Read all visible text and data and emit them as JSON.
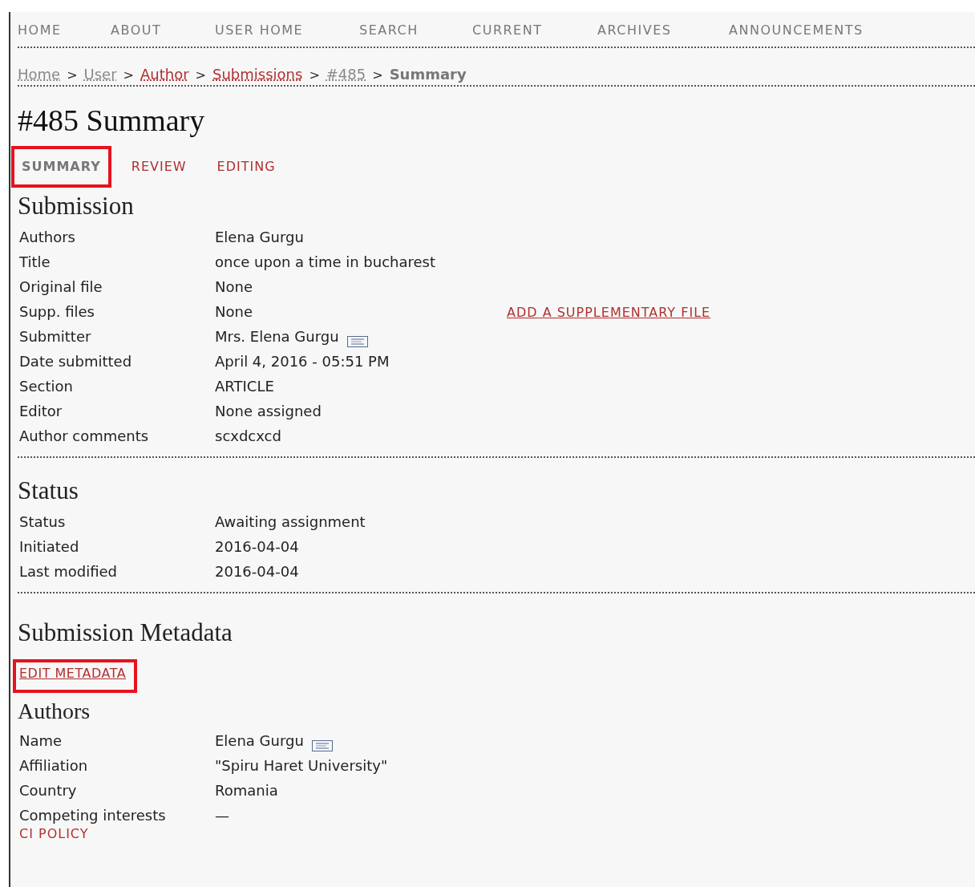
{
  "nav": [
    {
      "label": "HOME"
    },
    {
      "label": "ABOUT"
    },
    {
      "label": "USER HOME"
    },
    {
      "label": "SEARCH"
    },
    {
      "label": "CURRENT"
    },
    {
      "label": "ARCHIVES"
    },
    {
      "label": "ANNOUNCEMENTS"
    }
  ],
  "breadcrumb": [
    {
      "label": "Home",
      "kind": "plain"
    },
    {
      "label": "User",
      "kind": "plain"
    },
    {
      "label": "Author",
      "kind": "link"
    },
    {
      "label": "Submissions",
      "kind": "link"
    },
    {
      "label": "#485",
      "kind": "plain"
    },
    {
      "label": "Summary",
      "kind": "current"
    }
  ],
  "breadcrumb_separator": ">",
  "title": "#485 Summary",
  "tabs": [
    {
      "label": "SUMMARY",
      "selected": true,
      "highlighted": true
    },
    {
      "label": "REVIEW",
      "selected": false,
      "highlighted": false
    },
    {
      "label": "EDITING",
      "selected": false,
      "highlighted": false
    }
  ],
  "sections": [
    {
      "heading": "Submission",
      "rows": [
        {
          "label": "Authors",
          "value": "Elena Gurgu",
          "email_icon": false
        },
        {
          "label": "Title",
          "value": "once upon a time in bucharest",
          "email_icon": false
        },
        {
          "label": "Original file",
          "value": "None",
          "email_icon": false
        },
        {
          "label": "Supp. files",
          "value": "None",
          "email_icon": false,
          "action": "ADD A SUPPLEMENTARY FILE"
        },
        {
          "label": "Submitter",
          "value": "Mrs. Elena Gurgu",
          "email_icon": true
        },
        {
          "label": "Date submitted",
          "value": "April 4, 2016 - 05:51 PM",
          "email_icon": false
        },
        {
          "label": "Section",
          "value": "ARTICLE",
          "email_icon": false
        },
        {
          "label": "Editor",
          "value": "None assigned",
          "email_icon": false
        },
        {
          "label": "Author comments",
          "value": "scxdcxcd",
          "email_icon": false
        }
      ]
    },
    {
      "heading": "Status",
      "rows": [
        {
          "label": "Status",
          "value": "Awaiting assignment",
          "email_icon": false
        },
        {
          "label": "Initiated",
          "value": "2016-04-04",
          "email_icon": false
        },
        {
          "label": "Last modified",
          "value": "2016-04-04",
          "email_icon": false
        }
      ]
    }
  ],
  "metadata": {
    "heading": "Submission Metadata",
    "edit_link": {
      "label": "EDIT METADATA",
      "highlighted": true
    },
    "subheading": "Authors",
    "rows": [
      {
        "label": "Name",
        "value": "Elena Gurgu",
        "email_icon": true
      },
      {
        "label": "Affiliation",
        "value": "\"Spiru Haret University\"",
        "email_icon": false
      },
      {
        "label": "Country",
        "value": "Romania",
        "email_icon": false
      },
      {
        "label": "Competing interests",
        "value": "—",
        "email_icon": false
      }
    ],
    "policy_link": "CI POLICY"
  }
}
